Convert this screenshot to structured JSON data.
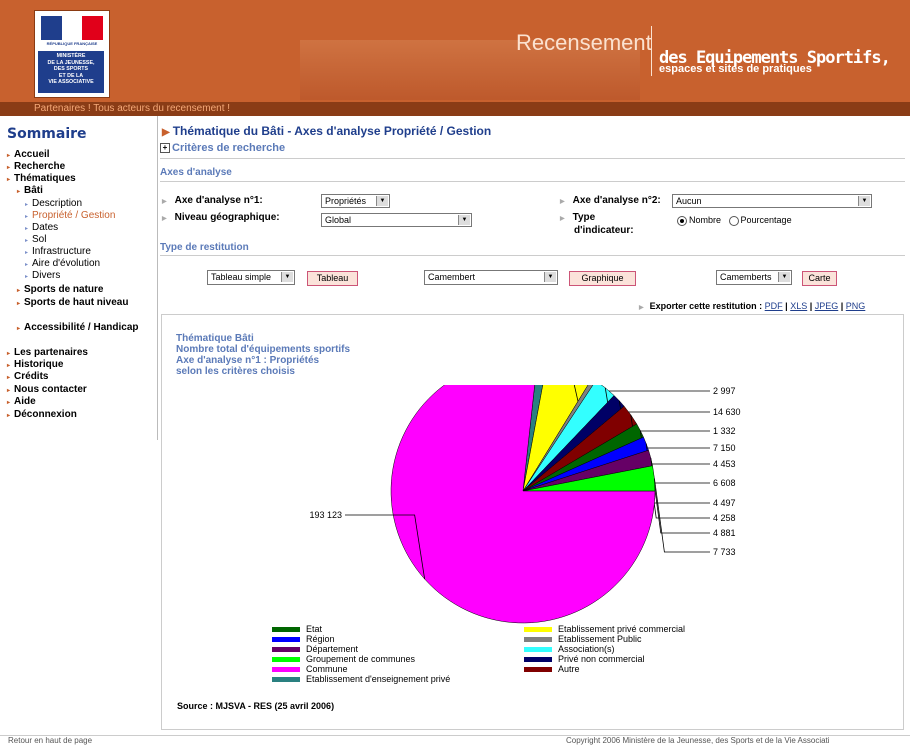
{
  "header": {
    "logo": {
      "line1": "Liberté · Égalité · Fraternité",
      "line2": "RÉPUBLIQUE FRANÇAISE",
      "ministry": [
        "MINISTÈRE",
        "DE LA JEUNESSE,",
        "DES SPORTS",
        "ET DE LA",
        "VIE ASSOCIATIVE"
      ]
    },
    "title_word": "Recensement",
    "subtitle1": "des Equipements Sportifs,",
    "subtitle2": "espaces et sites de pratiques",
    "tagline": "Partenaires ! Tous acteurs du recensement !"
  },
  "sidebar": {
    "title": "Sommaire",
    "items": [
      {
        "label": "Accueil"
      },
      {
        "label": "Recherche"
      },
      {
        "label": "Thématiques"
      },
      {
        "label": "Bâti"
      },
      {
        "label": "Description"
      },
      {
        "label": "Propriété / Gestion"
      },
      {
        "label": "Dates"
      },
      {
        "label": "Sol"
      },
      {
        "label": "Infrastructure"
      },
      {
        "label": "Aire d'évolution"
      },
      {
        "label": "Divers"
      },
      {
        "label": "Sports de nature"
      },
      {
        "label": "Sports de haut niveau"
      },
      {
        "label": "Accessibilité / Handicap"
      },
      {
        "label": "Les partenaires"
      },
      {
        "label": "Historique"
      },
      {
        "label": "Crédits"
      },
      {
        "label": "Nous contacter"
      },
      {
        "label": "Aide"
      },
      {
        "label": "Déconnexion"
      }
    ]
  },
  "main": {
    "title": "Thématique du Bâti - Axes d'analyse Propriété / Gestion",
    "criteria": "Critères de recherche",
    "axes_heading": "Axes d'analyse",
    "axe1_label": "Axe d'analyse n°1:",
    "axe1_value": "Propriétés",
    "axe2_label": "Axe d'analyse n°2:",
    "axe2_value": "Aucun",
    "niveau_label": "Niveau géographique:",
    "niveau_value": "Global",
    "type_ind_label1": "Type",
    "type_ind_label2": "d'indicateur:",
    "radio_nombre": "Nombre",
    "radio_pourcentage": "Pourcentage",
    "restitution_heading": "Type de restitution",
    "tableau_select": "Tableau simple",
    "tableau_btn": "Tableau",
    "graph_select": "Camembert",
    "graph_btn": "Graphique",
    "carte_select": "Camemberts",
    "carte_btn": "Carte",
    "export_label": "Exporter cette restitution :",
    "export_links": [
      "PDF",
      "XLS",
      "JPEG",
      "PNG"
    ],
    "chart_heading": [
      "Thématique Bâti",
      "Nombre total d'équipements sportifs",
      "Axe d'analyse n°1 : Propriétés",
      "selon les critères choisis"
    ],
    "source": "Source : MJSVA - RES (25 avril 2006)"
  },
  "chart_data": {
    "type": "pie",
    "slices": [
      {
        "name": "Etablissement d'enseignement privé",
        "value": 2997,
        "label": "2 997",
        "color": "#2a8080"
      },
      {
        "name": "Etablissement privé commercial",
        "value": 14630,
        "label": "14 630",
        "color": "#ffff00"
      },
      {
        "name": "Etablissement Public",
        "value": 1332,
        "label": "1 332",
        "color": "#808080"
      },
      {
        "name": "Association(s)",
        "value": 7150,
        "label": "7 150",
        "color": "#33ffff"
      },
      {
        "name": "Privé non commercial",
        "value": 4453,
        "label": "4 453",
        "color": "#000066"
      },
      {
        "name": "Autre",
        "value": 6608,
        "label": "6 608",
        "color": "#800000"
      },
      {
        "name": "Etat",
        "value": 4497,
        "label": "4 497",
        "color": "#006600"
      },
      {
        "name": "Région",
        "value": 4258,
        "label": "4 258",
        "color": "#0000ff"
      },
      {
        "name": "Département",
        "value": 4881,
        "label": "4 881",
        "color": "#660066"
      },
      {
        "name": "Groupement de communes",
        "value": 7733,
        "label": "7 733",
        "color": "#00ff00"
      },
      {
        "name": "Commune",
        "value": 193123,
        "label": "193 123",
        "color": "#ff00ff"
      }
    ],
    "legend_left": [
      "Etat",
      "Région",
      "Département",
      "Groupement de communes",
      "Commune",
      "Etablissement d'enseignement privé"
    ],
    "legend_right": [
      "Etablissement privé commercial",
      "Etablissement Public",
      "Association(s)",
      "Privé non commercial",
      "Autre"
    ]
  },
  "footer": {
    "left": "Retour en haut de page",
    "right": "Copyright 2006 Ministère de la Jeunesse, des Sports et de la Vie Associati"
  }
}
